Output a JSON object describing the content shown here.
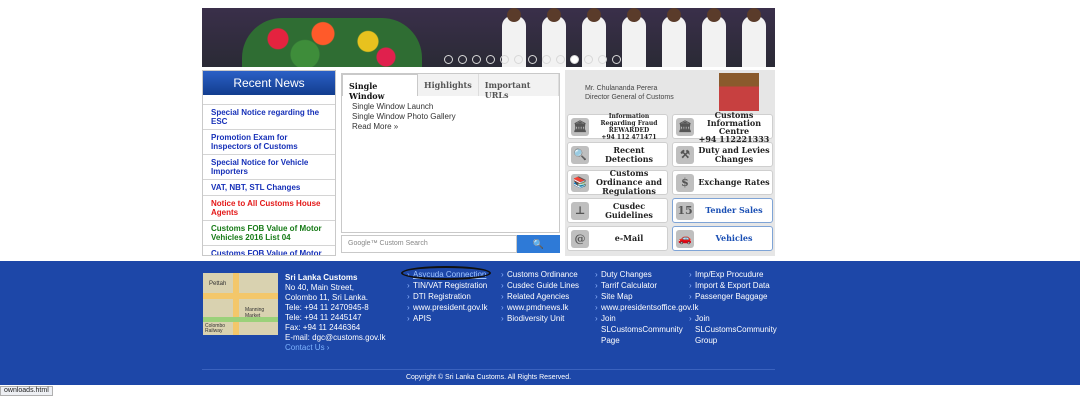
{
  "hero": {
    "slide_count": 13,
    "active_slide": 9
  },
  "news": {
    "title": "Recent News",
    "items": [
      {
        "text": "Special Notice regarding the ESC",
        "cls": "c-blue"
      },
      {
        "text": "Promotion Exam for Inspectors of Customs",
        "cls": "c-blue"
      },
      {
        "text": "Special Notice for Vehicle Importers",
        "cls": "c-blue"
      },
      {
        "text": "VAT, NBT, STL Changes",
        "cls": "c-blue"
      },
      {
        "text": "Notice to All Customs House Agents",
        "cls": "c-red"
      },
      {
        "text": "Customs FOB Value of Motor Vehicles 2016 List 04",
        "cls": "c-green"
      },
      {
        "text": "Customs FOB Value of Motor",
        "cls": "c-blue"
      }
    ]
  },
  "tabs": {
    "labels": [
      "Single Window",
      "Highlights",
      "Important URLs"
    ],
    "links": [
      "Single Window Launch",
      "Single Window Photo Gallery"
    ],
    "read_more": "Read More »"
  },
  "search": {
    "placeholder": "Google™ Custom Search",
    "button_icon": "search-icon"
  },
  "dg": {
    "name": "Mr. Chulananda Perera",
    "title": "Director General of Customs"
  },
  "buttons": {
    "fraud": {
      "l1": "Information Regarding Fraud",
      "l2": "REWARDED",
      "l3": "+94 112 471471"
    },
    "info": {
      "l1": "Customs Information",
      "l2": "Centre",
      "l3": "+94 112221333"
    },
    "detections": "Recent Detections",
    "duty": "Duty and Levies Changes",
    "ordinance": "Customs Ordinance and Regulations",
    "exchange": "Exchange Rates",
    "cusdec": "Cusdec Guidelines",
    "tender": "Tender Sales",
    "email": "e-Mail",
    "vehicles": "Vehicles"
  },
  "footer": {
    "org": "Sri Lanka Customs",
    "address": [
      "No 40, Main Street,",
      "Colombo 11, Sri Lanka.",
      "Tele: +94 11 2470945-8",
      "Tele: +94 11 2445147",
      "Fax: +94 11 2446364",
      "E-mail: dgc@customs.gov.lk"
    ],
    "contact": "Contact Us ›",
    "map_labels": {
      "pettah": "Pettah",
      "manning": "Manning Market",
      "colombo": "Colombo Railway"
    },
    "col1": [
      "Asycuda Connection",
      "TIN/VAT Registration",
      "DTI Registration",
      "www.president.gov.lk",
      "APIS"
    ],
    "col2": [
      "Customs Ordinance",
      "Cusdec Guide Lines",
      "Related Agencies",
      "www.pmdnews.lk",
      "Biodiversity Unit"
    ],
    "col3": [
      "Duty Changes",
      "Tarrif Calculator",
      "Site Map",
      "www.presidentsoffice.gov.lk",
      "Join SLCustomsCommunity Page"
    ],
    "col4": [
      "Imp/Exp Procudure",
      "Import & Export Data",
      "Passenger Baggage",
      "",
      "Join SLCustomsCommunity Group"
    ],
    "copyright": "Copyright © Sri Lanka Customs. All Rights Reserved."
  },
  "status_bar": "ownloads.html"
}
